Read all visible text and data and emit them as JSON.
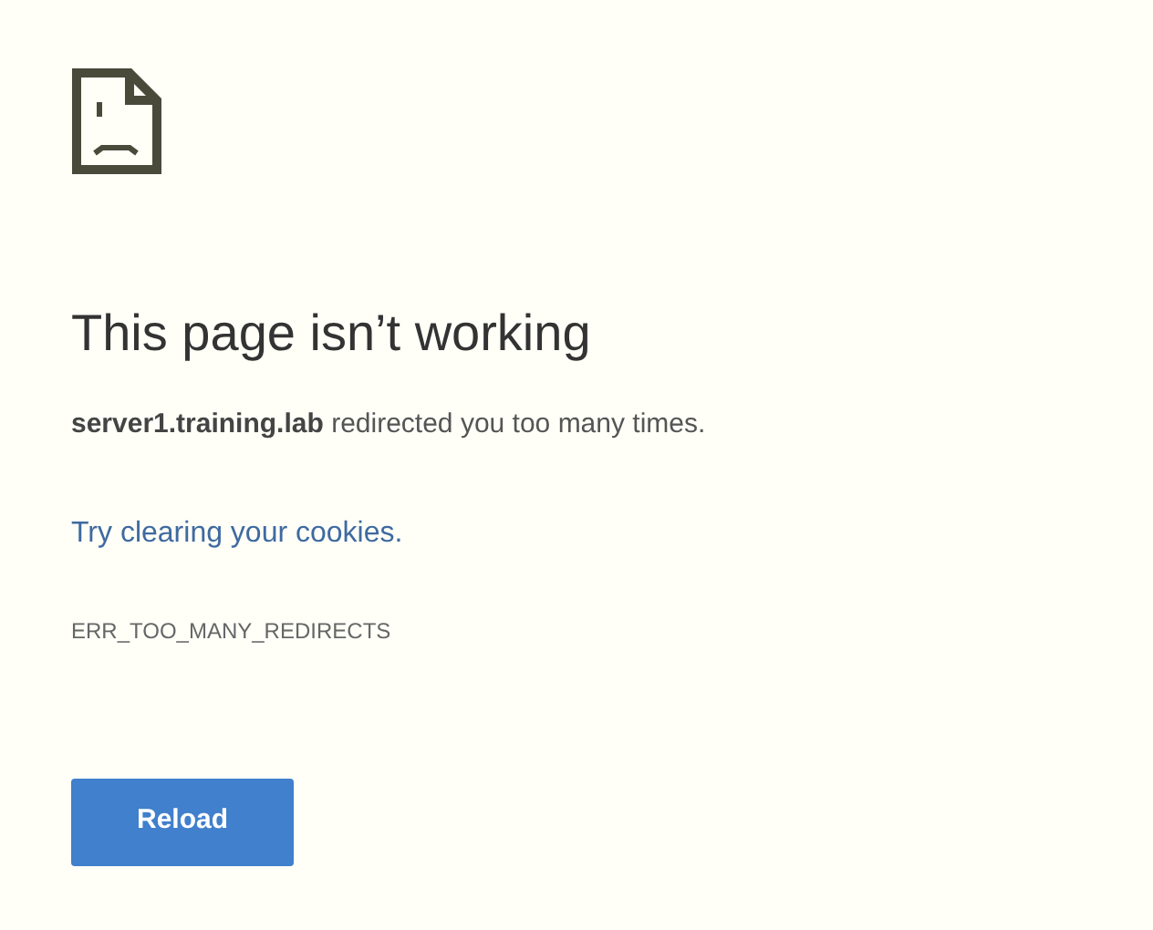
{
  "heading": "This page isn’t working",
  "message": "**server1.training.lab** redirected you too many times.",
  "suggestion_link": "Try clearing your cookies.",
  "error_code": "ERR_TOO_MANY_REDIRECTS",
  "buttons": [
    "Reload"
  ]
}
